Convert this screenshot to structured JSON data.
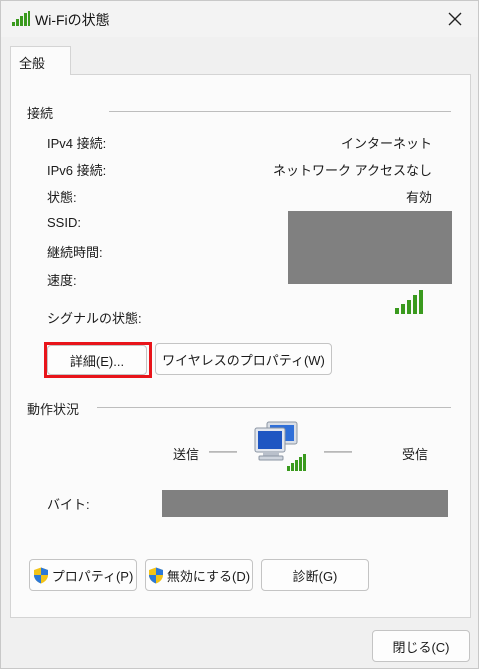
{
  "window": {
    "title": "Wi-Fiの状態",
    "icons": {
      "app": "wifi-signal-icon",
      "close": "close-icon"
    }
  },
  "tabs": [
    {
      "label": "全般"
    }
  ],
  "connection": {
    "section_title": "接続",
    "rows": [
      {
        "label": "IPv4 接続:",
        "value": "インターネット"
      },
      {
        "label": "IPv6 接続:",
        "value": "ネットワーク アクセスなし"
      },
      {
        "label": "状態:",
        "value": "有効"
      },
      {
        "label": "SSID:",
        "value": ""
      },
      {
        "label": "継続時間:",
        "value": ""
      },
      {
        "label": "速度:",
        "value": ""
      }
    ],
    "signal_label": "シグナルの状態:",
    "signal_icon": "signal-bars-icon",
    "details_button": "詳細(E)...",
    "wireless_props_button": "ワイヤレスのプロパティ(W)"
  },
  "activity": {
    "section_title": "動作状況",
    "sent_label": "送信",
    "received_label": "受信",
    "network_icon": "network-computers-icon",
    "bytes_label": "バイト:"
  },
  "buttons": {
    "properties": "プロパティ(P)",
    "disable": "無効にする(D)",
    "diagnose": "診断(G)",
    "close": "閉じる(C)"
  },
  "colors": {
    "highlight": "#e8141a",
    "signal_green": "#3a9a1e",
    "redaction": "#808080"
  }
}
